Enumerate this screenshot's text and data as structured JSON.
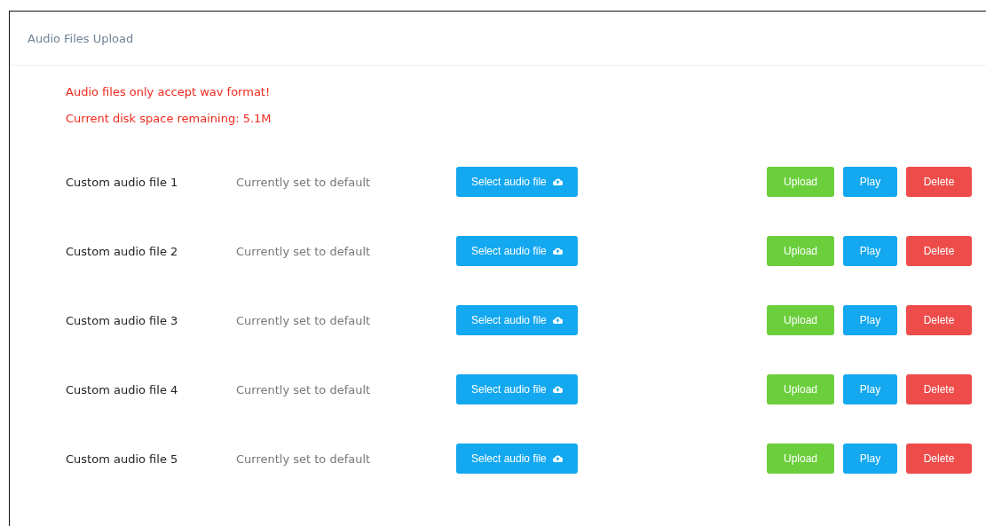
{
  "panel": {
    "title": "Audio Files Upload"
  },
  "notices": [
    "Audio files only accept wav format!",
    "Current disk space remaining: 5.1M"
  ],
  "files": [
    {
      "name": "Custom audio file 1",
      "status": "Currently set to default",
      "select_label": "Select audio file",
      "actions": [
        "Upload",
        "Play",
        "Delete"
      ]
    },
    {
      "name": "Custom audio file 2",
      "status": "Currently set to default",
      "select_label": "Select audio file",
      "actions": [
        "Upload",
        "Play",
        "Delete"
      ]
    },
    {
      "name": "Custom audio file 3",
      "status": "Currently set to default",
      "select_label": "Select audio file",
      "actions": [
        "Upload",
        "Play",
        "Delete"
      ]
    },
    {
      "name": "Custom audio file 4",
      "status": "Currently set to default",
      "select_label": "Select audio file",
      "actions": [
        "Upload",
        "Play",
        "Delete"
      ]
    },
    {
      "name": "Custom audio file 5",
      "status": "Currently set to default",
      "select_label": "Select audio file",
      "actions": [
        "Upload",
        "Play",
        "Delete"
      ]
    }
  ]
}
